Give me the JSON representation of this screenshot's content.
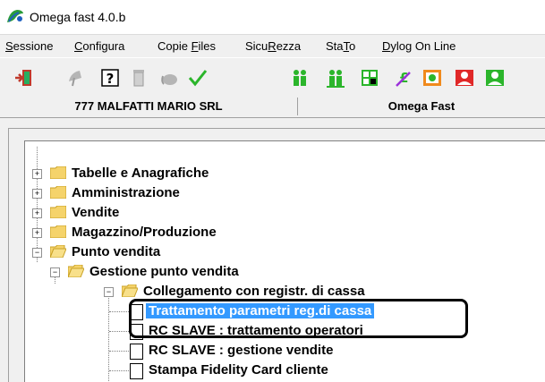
{
  "window": {
    "title": "Omega fast 4.0.b",
    "icon": "omega-app-icon"
  },
  "menu": [
    {
      "pre": "",
      "u": "S",
      "post": "essione"
    },
    {
      "pre": "",
      "u": "C",
      "post": "onfigura"
    },
    {
      "pre": "Copie ",
      "u": "F",
      "post": "iles"
    },
    {
      "pre": "Sicu",
      "u": "R",
      "post": "ezza"
    },
    {
      "pre": "Sta",
      "u": "T",
      "post": "o"
    },
    {
      "pre": "",
      "u": "D",
      "post": "ylog On Line"
    }
  ],
  "toolbar": {
    "icons": [
      "exit-door-icon",
      "satellite-dish-icon",
      "help-icon",
      "trash-icon",
      "paint-bucket-icon",
      "checkmark-icon",
      "users-icon",
      "users-alt-icon",
      "calculator-icon",
      "currency-icon",
      "money-icon",
      "money-alt-icon",
      "money-green-icon"
    ],
    "colors": {
      "green": "#2bb52b",
      "orange": "#f08a1d",
      "red": "#e02828"
    }
  },
  "header": {
    "company": "777 MALFATTI MARIO SRL",
    "product": "Omega Fast"
  },
  "tree": {
    "items": [
      {
        "label": "Tabelle e Anagrafiche",
        "type": "folder",
        "state": "collapsed"
      },
      {
        "label": "Amministrazione",
        "type": "folder",
        "state": "collapsed"
      },
      {
        "label": "Vendite",
        "type": "folder",
        "state": "collapsed"
      },
      {
        "label": "Magazzino/Produzione",
        "type": "folder",
        "state": "collapsed"
      },
      {
        "label": "Punto vendita",
        "type": "folder",
        "state": "expanded"
      },
      {
        "label": "Gestione punto vendita",
        "type": "folder",
        "state": "expanded"
      },
      {
        "label": "Collegamento con registr. di cassa",
        "type": "folder",
        "state": "expanded"
      },
      {
        "label": "Trattamento parametri reg.di cassa",
        "type": "document",
        "selected": true
      },
      {
        "label": "RC SLAVE : trattamento operatori",
        "type": "document"
      },
      {
        "label": "RC SLAVE : gestione vendite",
        "type": "document"
      },
      {
        "label": "Stampa Fidelity Card cliente",
        "type": "document"
      }
    ],
    "selection_color": "#3399ff"
  }
}
